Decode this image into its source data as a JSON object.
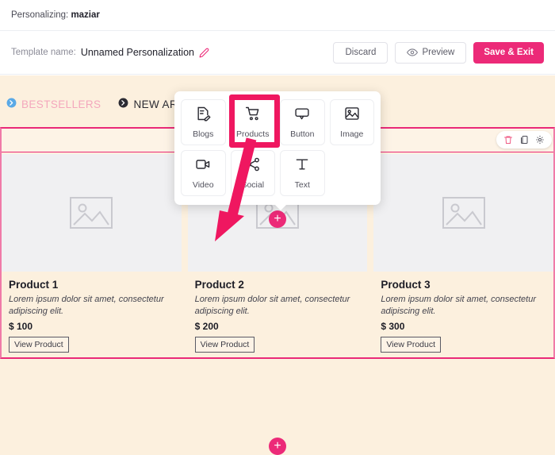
{
  "topbar": {
    "prefix": "Personalizing:",
    "user": "maziar"
  },
  "toolbar": {
    "template_label": "Template name:",
    "template_name": "Unnamed Personalization",
    "edit_icon": "pencil-icon",
    "discard_label": "Discard",
    "preview_label": "Preview",
    "preview_icon": "eye-icon",
    "save_label": "Save & Exit",
    "accent_color": "#ec2a78"
  },
  "canvas": {
    "background_color": "#fcf0de",
    "nav": [
      {
        "label": "BESTSELLERS",
        "icon": "circle-arrow-right-icon",
        "icon_color": "#5aa9e6",
        "text_color": "#f4a7bd"
      },
      {
        "label": "NEW ARRIVA",
        "icon": "circle-arrow-right-icon",
        "icon_color": "#2b2b33",
        "text_color": "#2b2b33"
      }
    ],
    "section_toolbar": [
      {
        "name": "delete-icon",
        "color": "#ef5a83"
      },
      {
        "name": "duplicate-icon",
        "color": "#4a4a55"
      },
      {
        "name": "settings-gear-icon",
        "color": "#4a4a55"
      }
    ],
    "add_block_label": "+",
    "section_border_color": "#ea2a78"
  },
  "widget_panel": {
    "items": [
      {
        "label": "Blogs",
        "icon": "blog-note-icon"
      },
      {
        "label": "Products",
        "icon": "shopping-cart-icon",
        "highlighted": true
      },
      {
        "label": "Button",
        "icon": "button-chat-icon"
      },
      {
        "label": "Image",
        "icon": "image-picture-icon"
      },
      {
        "label": "Video",
        "icon": "video-camera-icon"
      },
      {
        "label": "Social",
        "icon": "share-social-icon"
      },
      {
        "label": "Text",
        "icon": "text-t-icon"
      }
    ],
    "highlight_color": "#ef1760"
  },
  "products": {
    "cta_label": "View Product",
    "placeholder_icon": "image-placeholder-icon",
    "items": [
      {
        "title": "Product 1",
        "description": "Lorem ipsum dolor sit amet, consectetur adipiscing elit.",
        "price": "$ 100"
      },
      {
        "title": "Product 2",
        "description": "Lorem ipsum dolor sit amet, consectetur adipiscing elit.",
        "price": "$ 200"
      },
      {
        "title": "Product 3",
        "description": "Lorem ipsum dolor sit amet, consectetur adipiscing elit.",
        "price": "$ 300"
      }
    ]
  }
}
